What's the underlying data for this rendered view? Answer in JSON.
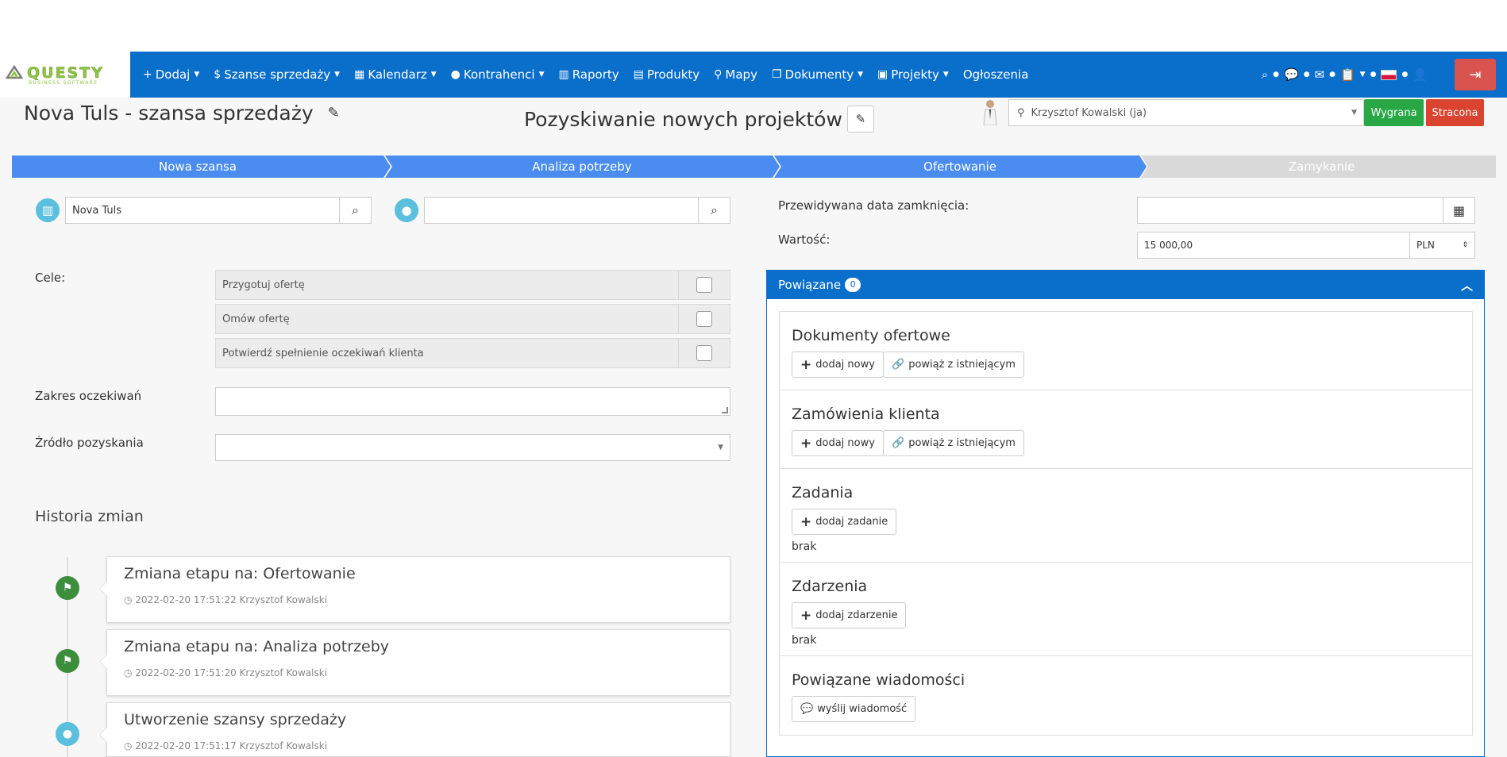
{
  "logo": {
    "text": "QUESTY",
    "subtitle": "BUSINESS SOFTWARE"
  },
  "nav": {
    "items": [
      {
        "label": "Dodaj",
        "icon": "plus-icon",
        "glyph": "+",
        "caret": true
      },
      {
        "label": "Szanse sprzedaży",
        "icon": "dollar-icon",
        "glyph": "$",
        "caret": true
      },
      {
        "label": "Kalendarz",
        "icon": "calendar-icon",
        "glyph": "▦",
        "caret": true
      },
      {
        "label": "Kontrahenci",
        "icon": "user-icon",
        "glyph": "●",
        "caret": true
      },
      {
        "label": "Raporty",
        "icon": "bar-chart-icon",
        "glyph": "▥",
        "caret": false
      },
      {
        "label": "Produkty",
        "icon": "table-icon",
        "glyph": "▤",
        "caret": false
      },
      {
        "label": "Mapy",
        "icon": "map-marker-icon",
        "glyph": "⚲",
        "caret": false
      },
      {
        "label": "Dokumenty",
        "icon": "documents-icon",
        "glyph": "❐",
        "caret": true
      },
      {
        "label": "Projekty",
        "icon": "projects-icon",
        "glyph": "▣",
        "caret": true
      },
      {
        "label": "Ogłoszenia",
        "icon": "",
        "glyph": "",
        "caret": false
      }
    ]
  },
  "header": {
    "title": "Nova Tuls - szansa sprzedaży",
    "process": "Pozyskiwanie nowych projektów",
    "owner": "Krzysztof Kowalski (ja)",
    "won_label": "Wygrana",
    "lost_label": "Stracona"
  },
  "stages": [
    {
      "label": "Nowa szansa",
      "active": true
    },
    {
      "label": "Analiza potrzeby",
      "active": true
    },
    {
      "label": "Ofertowanie",
      "active": true
    },
    {
      "label": "Zamykanie",
      "active": false
    }
  ],
  "colors": {
    "stage_active": "#4a8cf0",
    "stage_inactive": "#d9d9d9",
    "nav": "#0a6ecb",
    "won": "#28a745",
    "lost": "#d9432f",
    "timeline_green": "#3c8d3c",
    "timeline_blue": "#5bc0de"
  },
  "form": {
    "company_value": "Nova Tuls",
    "contact_value": "",
    "goals_label": "Cele:",
    "goals": [
      {
        "label": "Przygotuj ofertę"
      },
      {
        "label": "Omów ofertę"
      },
      {
        "label": "Potwierdź spełnienie oczekiwań klienta"
      }
    ],
    "scope_label": "Zakres oczekiwań",
    "source_label": "Źródło pozyskania"
  },
  "right": {
    "close_date_label": "Przewidywana data zamknięcia:",
    "value_label": "Wartość:",
    "value": "15 000,00",
    "currency": "PLN"
  },
  "related": {
    "title": "Powiązane",
    "count": "0",
    "sections": [
      {
        "title": "Dokumenty ofertowe",
        "buttons": [
          {
            "label": "dodaj nowy",
            "icon": "plus-icon"
          },
          {
            "label": "powiąż z istniejącym",
            "icon": "link-icon"
          }
        ],
        "empty": ""
      },
      {
        "title": "Zamówienia klienta",
        "buttons": [
          {
            "label": "dodaj nowy",
            "icon": "plus-icon"
          },
          {
            "label": "powiąż z istniejącym",
            "icon": "link-icon"
          }
        ],
        "empty": ""
      },
      {
        "title": "Zadania",
        "buttons": [
          {
            "label": "dodaj zadanie",
            "icon": "plus-icon"
          }
        ],
        "empty": "brak"
      },
      {
        "title": "Zdarzenia",
        "buttons": [
          {
            "label": "dodaj zdarzenie",
            "icon": "plus-icon"
          }
        ],
        "empty": "brak"
      },
      {
        "title": "Powiązane wiadomości",
        "buttons": [
          {
            "label": "wyślij wiadomość",
            "icon": "comments-icon"
          }
        ],
        "empty": ""
      }
    ]
  },
  "history": {
    "title": "Historia zmian",
    "entries": [
      {
        "title": "Zmiana etapu na: Ofertowanie",
        "meta": "2022-02-20 17:51:22 Krzysztof Kowalski",
        "icon": "flag-icon"
      },
      {
        "title": "Zmiana etapu na: Analiza potrzeby",
        "meta": "2022-02-20 17:51:20 Krzysztof Kowalski",
        "icon": "flag-icon"
      },
      {
        "title": "Utworzenie szansy sprzedaży",
        "meta": "2022-02-20 17:51:17 Krzysztof Kowalski",
        "icon": "user-icon"
      }
    ]
  }
}
